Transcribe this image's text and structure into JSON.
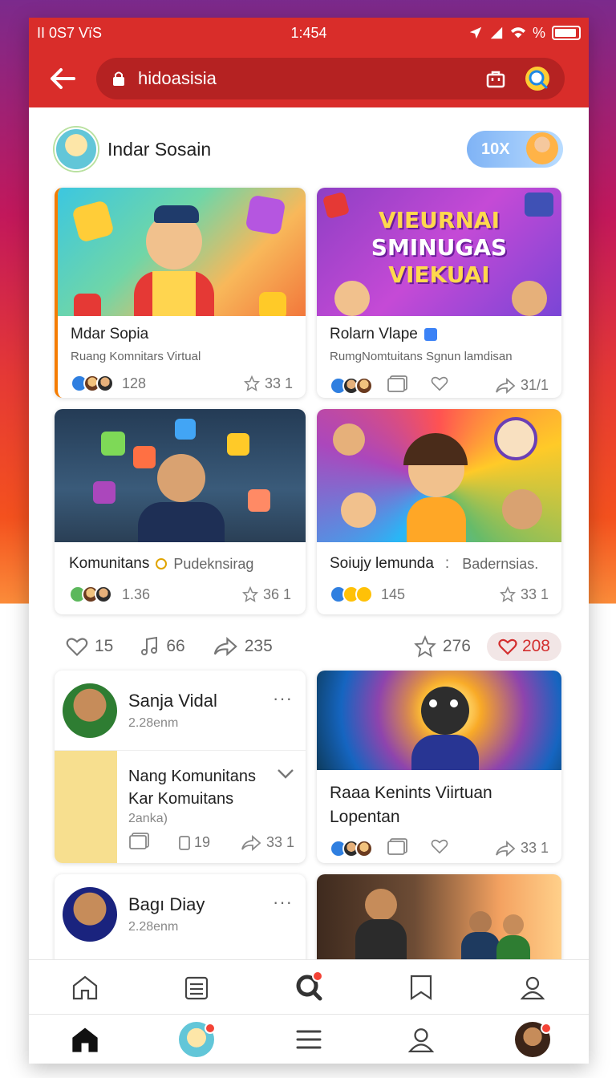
{
  "status_bar": {
    "left": "II 0S7 VïS",
    "time": "1:454",
    "right_text": "%"
  },
  "url_bar": {
    "text": "hidoasisia"
  },
  "profile": {
    "name": "Indar Sosain",
    "pill_label": "10X"
  },
  "grid": [
    {
      "title": "Mdar Sopia",
      "subtitle": "Ruang Komnitars Virtual",
      "count": "128",
      "star_count": "33 1"
    },
    {
      "title": "Rolarn Vlape",
      "subtitle": "RumgNomtuitans Sgnun lamdisan",
      "share_count": "31/1",
      "banner_lines": [
        "VIEURNAI",
        "SMINUGAS",
        "VIEKUAI"
      ]
    },
    {
      "title": "Komunitans",
      "subtitle": "Pudeknsirag",
      "count": "1.36",
      "star_count": "36 1"
    },
    {
      "title": "Soiujy lemunda",
      "subtitle": "Badernsias.",
      "count": "145",
      "star_count": "33 1"
    }
  ],
  "actions": {
    "likes": "15",
    "music": "66",
    "shares": "235",
    "stars": "276",
    "hearts": "208"
  },
  "posts": [
    {
      "name": "Sanja Vidal",
      "time": "2.28enm",
      "text_line1": "Nang Komunitans",
      "text_line2": "Kar Komuitans",
      "text_line3": "2anka)",
      "count": "19",
      "share_count": "33 1",
      "more": "···"
    },
    {
      "title_line1": "Raaa Kenints Viirtuan",
      "title_line2": "Lopentan",
      "share_count": "33 1"
    },
    {
      "name": "Bagı Diay",
      "time": "2.28enm",
      "more": "···"
    }
  ]
}
